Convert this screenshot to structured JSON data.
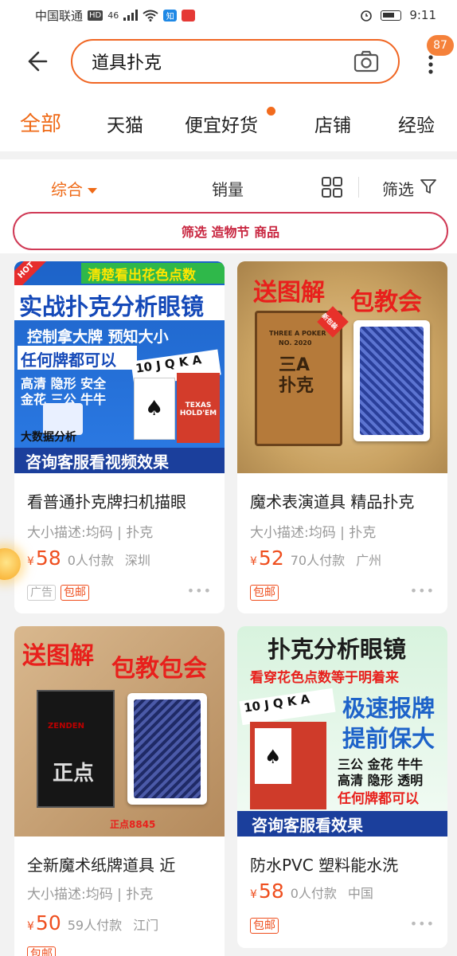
{
  "status_bar": {
    "carrier": "中国联通",
    "hd": "HD",
    "signal": "46",
    "app1": "知",
    "time": "9:11"
  },
  "header": {
    "search_value": "道具扑克",
    "badge": "87"
  },
  "tabs": [
    {
      "label": "全部",
      "active": true
    },
    {
      "label": "天猫"
    },
    {
      "label": "便宜好货",
      "dot": true
    },
    {
      "label": "店铺"
    },
    {
      "label": "经验"
    }
  ],
  "filters": {
    "sort_default": "综合",
    "sort_sales": "销量",
    "filter": "筛选",
    "promo": "筛选 造物节 商品"
  },
  "products": [
    {
      "title": "看普通扑克牌扫机描眼",
      "desc": "大小描述:均码 | 扑克",
      "yen": "¥",
      "price": "58",
      "sold": "0人付款",
      "city": "深圳",
      "tags": [
        "广告",
        "包邮"
      ],
      "image": {
        "hot": "HOT",
        "banner": "清楚看出花色点数",
        "headline": "实战扑克分析眼镜",
        "line1": "控制拿大牌  预知大小",
        "line2": "任何牌都可以",
        "line3": "高清 隐形 安全",
        "line4": "金花 三公 牛牛",
        "line5": "大数据分析",
        "footer": "咨询客服看视频效果",
        "cards": "10 J Q K A",
        "box": "TEXAS HOLD'EM"
      }
    },
    {
      "title": "魔术表演道具 精品扑克",
      "desc": "大小描述:均码 | 扑克",
      "yen": "¥",
      "price": "52",
      "sold": "70人付款",
      "city": "广州",
      "tags": [
        "包邮"
      ],
      "image": {
        "left": "送图解",
        "right": "包教会",
        "box_brand": "THREE A POKER",
        "box_no": "NO. 2020",
        "box_big": "三A扑克",
        "new": "新包装"
      }
    },
    {
      "title": "全新魔术纸牌道具  近",
      "desc": "大小描述:均码 | 扑克",
      "yen": "¥",
      "price": "50",
      "sold": "59人付款",
      "city": "江门",
      "tags": [
        "包邮"
      ],
      "image": {
        "left": "送图解",
        "right": "包教包会",
        "box_brand": "ZENDEN",
        "box_big": "正点",
        "model": "正点8845"
      }
    },
    {
      "title": "防水PVC 塑料能水洗",
      "desc": "大小描述:均码 | 扑克",
      "yen": "¥",
      "price": "58",
      "sold": "0人付款",
      "city": "中国",
      "tags": [
        "包邮"
      ],
      "image": {
        "headline": "扑克分析眼镜",
        "line1": "看穿花色点数等于明着来",
        "line2": "极速报牌",
        "line3": "提前保大",
        "line4": "三公  金花  牛牛",
        "line5": "高清  隐形  透明",
        "line6": "任何牌都可以",
        "footer": "咨询客服看效果",
        "cards": "10 J Q K A"
      }
    }
  ],
  "colors": {
    "accent": "#ef6a17",
    "price": "#ef4f1f",
    "promo": "#c8253f"
  }
}
